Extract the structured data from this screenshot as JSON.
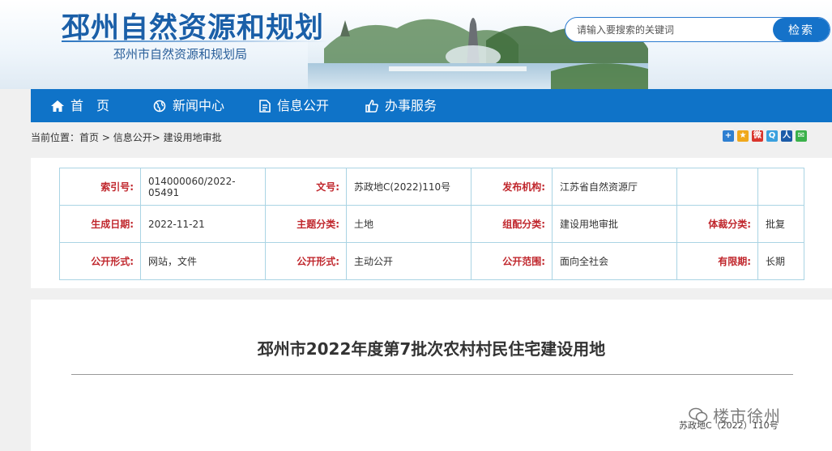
{
  "header": {
    "site_title": "邳州自然资源和规划",
    "site_subtitle": "邳州市自然资源和规划局"
  },
  "search": {
    "placeholder": "请输入要搜索的关键词",
    "button_label": "检索"
  },
  "nav": {
    "items": [
      {
        "label": "首　页",
        "icon": "home-icon"
      },
      {
        "label": "新闻中心",
        "icon": "globe-icon"
      },
      {
        "label": "信息公开",
        "icon": "document-icon"
      },
      {
        "label": "办事服务",
        "icon": "thumbs-up-icon"
      }
    ]
  },
  "breadcrumb": {
    "prefix": "当前位置：",
    "items": [
      "首页",
      "信息公开",
      "建设用地审批"
    ],
    "sep1": " > ",
    "sep2": "> "
  },
  "share": {
    "icons": [
      {
        "name": "share-add-icon",
        "color": "#2e7fd1",
        "glyph": "+"
      },
      {
        "name": "share-qzone-icon",
        "color": "#f0a81c",
        "glyph": "★"
      },
      {
        "name": "share-weibo-icon",
        "color": "#d9352d",
        "glyph": "微"
      },
      {
        "name": "share-qq-icon",
        "color": "#3aa0de",
        "glyph": "Q"
      },
      {
        "name": "share-renren-icon",
        "color": "#1c5ca8",
        "glyph": "人"
      },
      {
        "name": "share-wechat-icon",
        "color": "#3bb14a",
        "glyph": "✉"
      }
    ]
  },
  "info": {
    "rows": [
      [
        {
          "label": "索引号:",
          "value": "014000060/2022-05491"
        },
        {
          "label": "文号:",
          "value": "苏政地C(2022)110号"
        },
        {
          "label": "发布机构:",
          "value": "江苏省自然资源厅"
        },
        {
          "label": "",
          "value": ""
        }
      ],
      [
        {
          "label": "生成日期:",
          "value": "2022-11-21"
        },
        {
          "label": "主题分类:",
          "value": "土地"
        },
        {
          "label": "组配分类:",
          "value": "建设用地审批"
        },
        {
          "label": "体裁分类:",
          "value": "批复"
        }
      ],
      [
        {
          "label": "公开形式:",
          "value": "网站，文件"
        },
        {
          "label": "公开形式:",
          "value": "主动公开"
        },
        {
          "label": "公开范围:",
          "value": "面向全社会"
        },
        {
          "label": "有限期:",
          "value": "长期"
        }
      ]
    ]
  },
  "article": {
    "title": "邳州市2022年度第7批次农村村民住宅建设用地",
    "doc_number": "苏政地C（2022）110号",
    "watermark": "楼市徐州"
  },
  "colors": {
    "nav_bg": "#0f73c8",
    "label_red": "#c0272d",
    "title_blue": "#1a5fa8"
  }
}
